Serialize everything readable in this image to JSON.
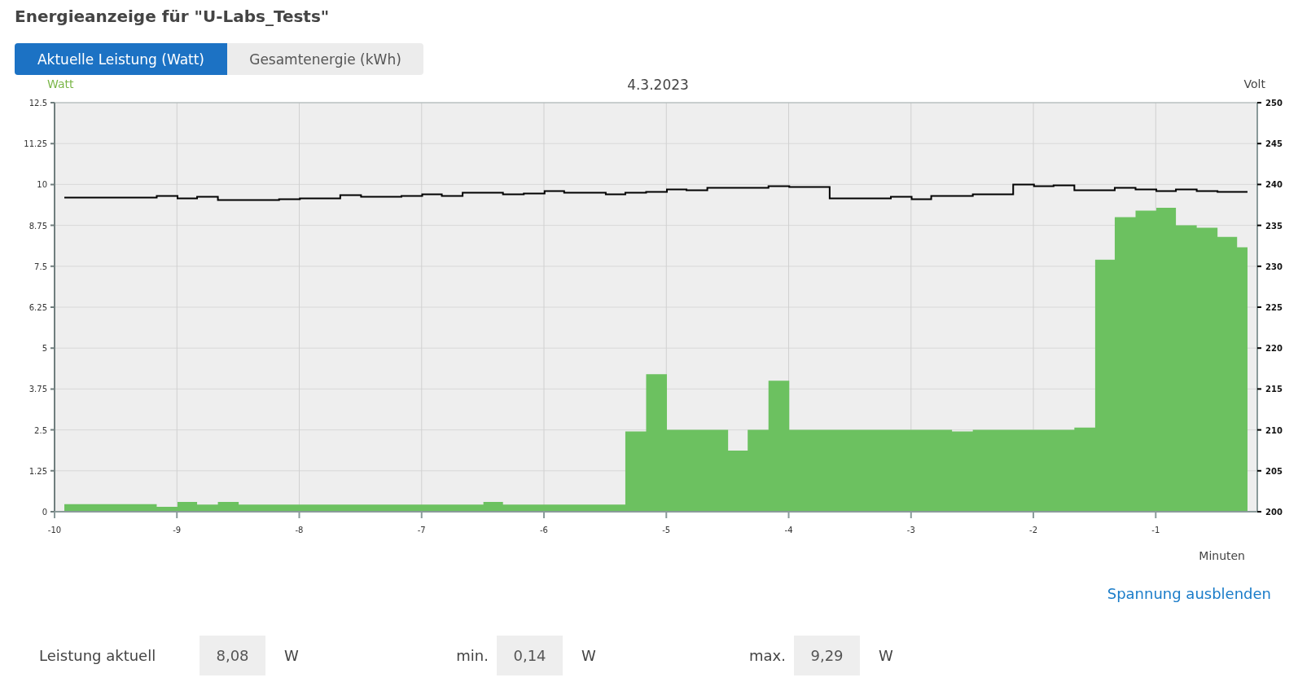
{
  "title": "Energieanzeige für \"U-Labs_Tests\"",
  "tabs": [
    {
      "label": "Aktuelle Leistung (Watt)",
      "selected": true
    },
    {
      "label": "Gesamtenergie (kWh)",
      "selected": false
    }
  ],
  "chart": {
    "chart_data": {
      "type": "area",
      "title": "4.3.2023",
      "xlabel": "Minuten",
      "ylabel": "Watt",
      "y2label": "Volt",
      "grid": true,
      "x": [
        -9.92,
        -9.75,
        -9.58,
        -9.42,
        -9.25,
        -9.08,
        -8.92,
        -8.75,
        -8.58,
        -8.42,
        -8.25,
        -8.08,
        -7.92,
        -7.75,
        -7.58,
        -7.42,
        -7.25,
        -7.08,
        -6.92,
        -6.75,
        -6.58,
        -6.42,
        -6.25,
        -6.08,
        -5.92,
        -5.75,
        -5.58,
        -5.42,
        -5.25,
        -5.08,
        -4.92,
        -4.75,
        -4.58,
        -4.42,
        -4.25,
        -4.08,
        -3.92,
        -3.75,
        -3.58,
        -3.42,
        -3.25,
        -3.08,
        -2.92,
        -2.75,
        -2.58,
        -2.42,
        -2.25,
        -2.08,
        -1.92,
        -1.75,
        -1.58,
        -1.42,
        -1.25,
        -1.08,
        -0.92,
        -0.75,
        -0.58,
        -0.42,
        -0.25
      ],
      "series": [
        {
          "color": "#6cc160",
          "values": [
            0.23,
            0.23,
            0.23,
            0.23,
            0.23,
            0.15,
            0.3,
            0.22,
            0.3,
            0.22,
            0.22,
            0.22,
            0.22,
            0.22,
            0.22,
            0.22,
            0.22,
            0.22,
            0.22,
            0.22,
            0.22,
            0.3,
            0.22,
            0.22,
            0.22,
            0.22,
            0.22,
            0.22,
            2.45,
            4.2,
            2.5,
            2.5,
            2.5,
            1.87,
            2.5,
            4.0,
            2.5,
            2.5,
            2.5,
            2.5,
            2.5,
            2.5,
            2.5,
            2.5,
            2.45,
            2.5,
            2.5,
            2.5,
            2.5,
            2.5,
            2.57,
            7.7,
            9.0,
            9.2,
            9.29,
            8.75,
            8.68,
            8.4,
            8.08
          ]
        },
        {
          "type": "line",
          "axis": "y2",
          "color": "#000000",
          "values": [
            238.4,
            238.4,
            238.4,
            238.4,
            238.4,
            238.6,
            238.3,
            238.5,
            238.1,
            238.1,
            238.1,
            238.2,
            238.3,
            238.3,
            238.7,
            238.5,
            238.5,
            238.6,
            238.8,
            238.6,
            239.0,
            239.0,
            238.8,
            238.9,
            239.2,
            239.0,
            239.0,
            238.8,
            239.0,
            239.1,
            239.4,
            239.3,
            239.6,
            239.6,
            239.6,
            239.8,
            239.7,
            239.7,
            238.3,
            238.3,
            238.3,
            238.5,
            238.2,
            238.6,
            238.6,
            238.8,
            238.8,
            240.0,
            239.8,
            239.9,
            239.3,
            239.3,
            239.6,
            239.4,
            239.2,
            239.4,
            239.2,
            239.1,
            239.1
          ]
        }
      ],
      "xlim": [
        -10,
        -0.17
      ],
      "ylim": [
        0,
        12.5
      ],
      "y2lim": [
        200,
        250
      ],
      "xticks": [
        -10,
        -9,
        -8,
        -7,
        -6,
        -5,
        -4,
        -3,
        -2,
        -1
      ],
      "yticks": [
        0,
        1.25,
        2.5,
        3.75,
        5,
        6.25,
        7.5,
        8.75,
        10,
        11.25,
        12.5
      ],
      "y2ticks": [
        200,
        205,
        210,
        215,
        220,
        225,
        230,
        235,
        240,
        245,
        250
      ]
    }
  },
  "toggle_link": "Spannung ausblenden",
  "stats": [
    {
      "label": "Leistung aktuell",
      "value": "8,08",
      "unit": "W"
    },
    {
      "label": "min.",
      "value": "0,14",
      "unit": "W"
    },
    {
      "label": "max.",
      "value": "9,29",
      "unit": "W"
    }
  ]
}
